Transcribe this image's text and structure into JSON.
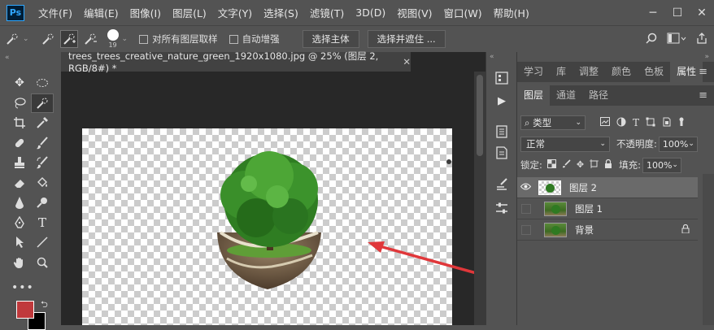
{
  "app": {
    "logo": "Ps"
  },
  "menu": [
    "文件(F)",
    "编辑(E)",
    "图像(I)",
    "图层(L)",
    "文字(Y)",
    "选择(S)",
    "滤镜(T)",
    "3D(D)",
    "视图(V)",
    "窗口(W)",
    "帮助(H)"
  ],
  "options": {
    "brush_size": "19",
    "sample_all_layers": "对所有图层取样",
    "auto_enhance": "自动增强",
    "select_subject": "选择主体",
    "select_and_mask": "选择并遮住 ..."
  },
  "document": {
    "tab_title": "trees_trees_creative_nature_green_1920x1080.jpg @ 25% (图层 2, RGB/8#) *",
    "colors": {
      "foreground": "#c0393c",
      "background": "#000000",
      "arrow": "#e0373a"
    }
  },
  "panels": {
    "top_tabs": [
      "学习",
      "库",
      "调整",
      "颜色",
      "色板",
      "属性"
    ],
    "layer_tabs": [
      "图层",
      "通道",
      "路径"
    ],
    "kind_filter": "类型",
    "blend_mode": "正常",
    "opacity_label": "不透明度:",
    "opacity_value": "100%",
    "lock_label": "锁定:",
    "fill_label": "填充:",
    "fill_value": "100%",
    "layers": [
      {
        "name": "图层 2",
        "visible": true,
        "selected": true
      },
      {
        "name": "图层 1",
        "visible": false,
        "selected": false
      },
      {
        "name": "背景",
        "visible": false,
        "selected": false,
        "locked": true
      }
    ]
  }
}
